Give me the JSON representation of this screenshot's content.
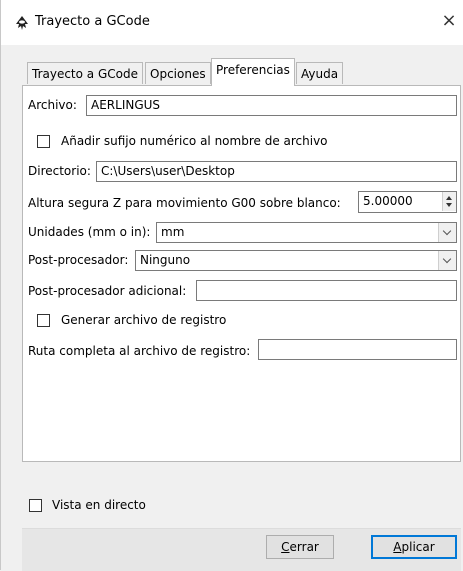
{
  "window": {
    "title": "Trayecto a GCode",
    "close_glyph": "×",
    "icon": "inkscape-icon"
  },
  "tabs": [
    {
      "label": "Trayecto a GCode",
      "active": false
    },
    {
      "label": "Opciones",
      "active": false
    },
    {
      "label": "Preferencias",
      "active": true
    },
    {
      "label": "Ayuda",
      "active": false
    }
  ],
  "preferences": {
    "archivo_label": "Archivo:",
    "archivo_value": "AERLINGUS",
    "sufijo_label": "Añadir sufijo numérico al nombre de archivo",
    "sufijo_checked": false,
    "directorio_label": "Directorio:",
    "directorio_value": "C:\\Users\\user\\Desktop",
    "altura_label": "Altura segura Z para movimiento G00 sobre blanco:",
    "altura_value": "5.00000",
    "unidades_label": "Unidades (mm o in):",
    "unidades_value": "mm",
    "post_label": "Post-procesador:",
    "post_value": "Ninguno",
    "post_adicional_label": "Post-procesador adicional:",
    "post_adicional_value": "",
    "registro_label": "Generar archivo de registro",
    "registro_checked": false,
    "ruta_label": "Ruta completa al archivo de registro:",
    "ruta_value": ""
  },
  "live_preview": {
    "label": "Vista en directo",
    "checked": false
  },
  "buttons": {
    "cerrar_first": "C",
    "cerrar_rest": "errar",
    "aplicar_first": "A",
    "aplicar_rest": "plicar"
  }
}
